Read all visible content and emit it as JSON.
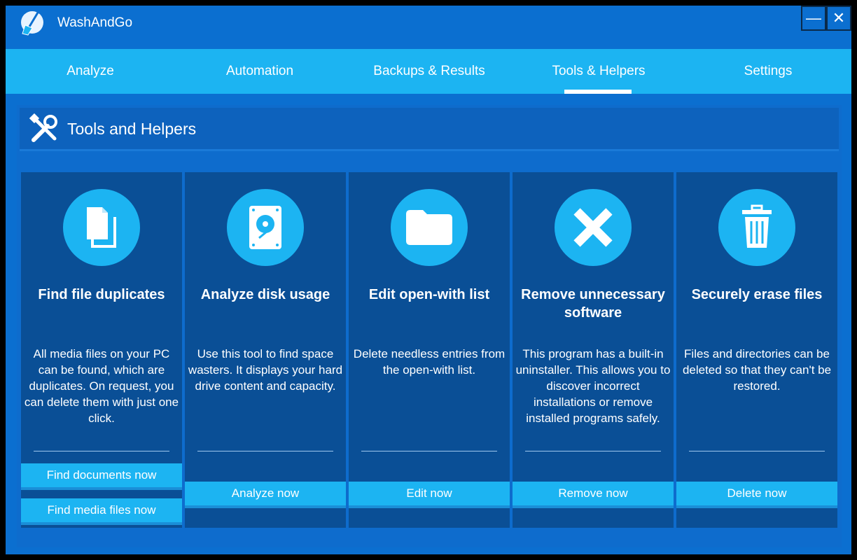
{
  "window": {
    "title": "WashAndGo"
  },
  "titlebar": {
    "minimize_glyph": "—",
    "close_glyph": "✕"
  },
  "tabs": [
    {
      "label": "Analyze"
    },
    {
      "label": "Automation"
    },
    {
      "label": "Backups & Results"
    },
    {
      "label": "Tools & Helpers",
      "active": true
    },
    {
      "label": "Settings"
    }
  ],
  "section": {
    "title": "Tools and Helpers",
    "icon": "tools-icon"
  },
  "cards": [
    {
      "icon": "documents-icon",
      "title": "Find file duplicates",
      "description": "All media files on your PC can be found, which are duplicates. On request, you can delete them with just one click.",
      "buttons": [
        "Find documents now",
        "Find media files now"
      ]
    },
    {
      "icon": "hard-drive-icon",
      "title": "Analyze disk usage",
      "description": "Use this tool to find space wasters. It displays your hard drive content and capacity.",
      "buttons": [
        "Analyze now"
      ]
    },
    {
      "icon": "folder-icon",
      "title": "Edit open-with list",
      "description": "Delete needless entries from the open-with list.",
      "buttons": [
        "Edit now"
      ]
    },
    {
      "icon": "x-icon",
      "title": "Remove unnecessary software",
      "description": "This program has a built-in uninstaller. This allows you to discover incorrect installations or remove installed programs safely.",
      "buttons": [
        "Remove now"
      ]
    },
    {
      "icon": "trash-icon",
      "title": "Securely erase files",
      "description": "Files and directories can be deleted so that they can't be restored.",
      "buttons": [
        "Delete now"
      ]
    }
  ],
  "colors": {
    "accent": "#1cb4f2",
    "background": "#0b6fd0",
    "card": "#0a4f96"
  }
}
